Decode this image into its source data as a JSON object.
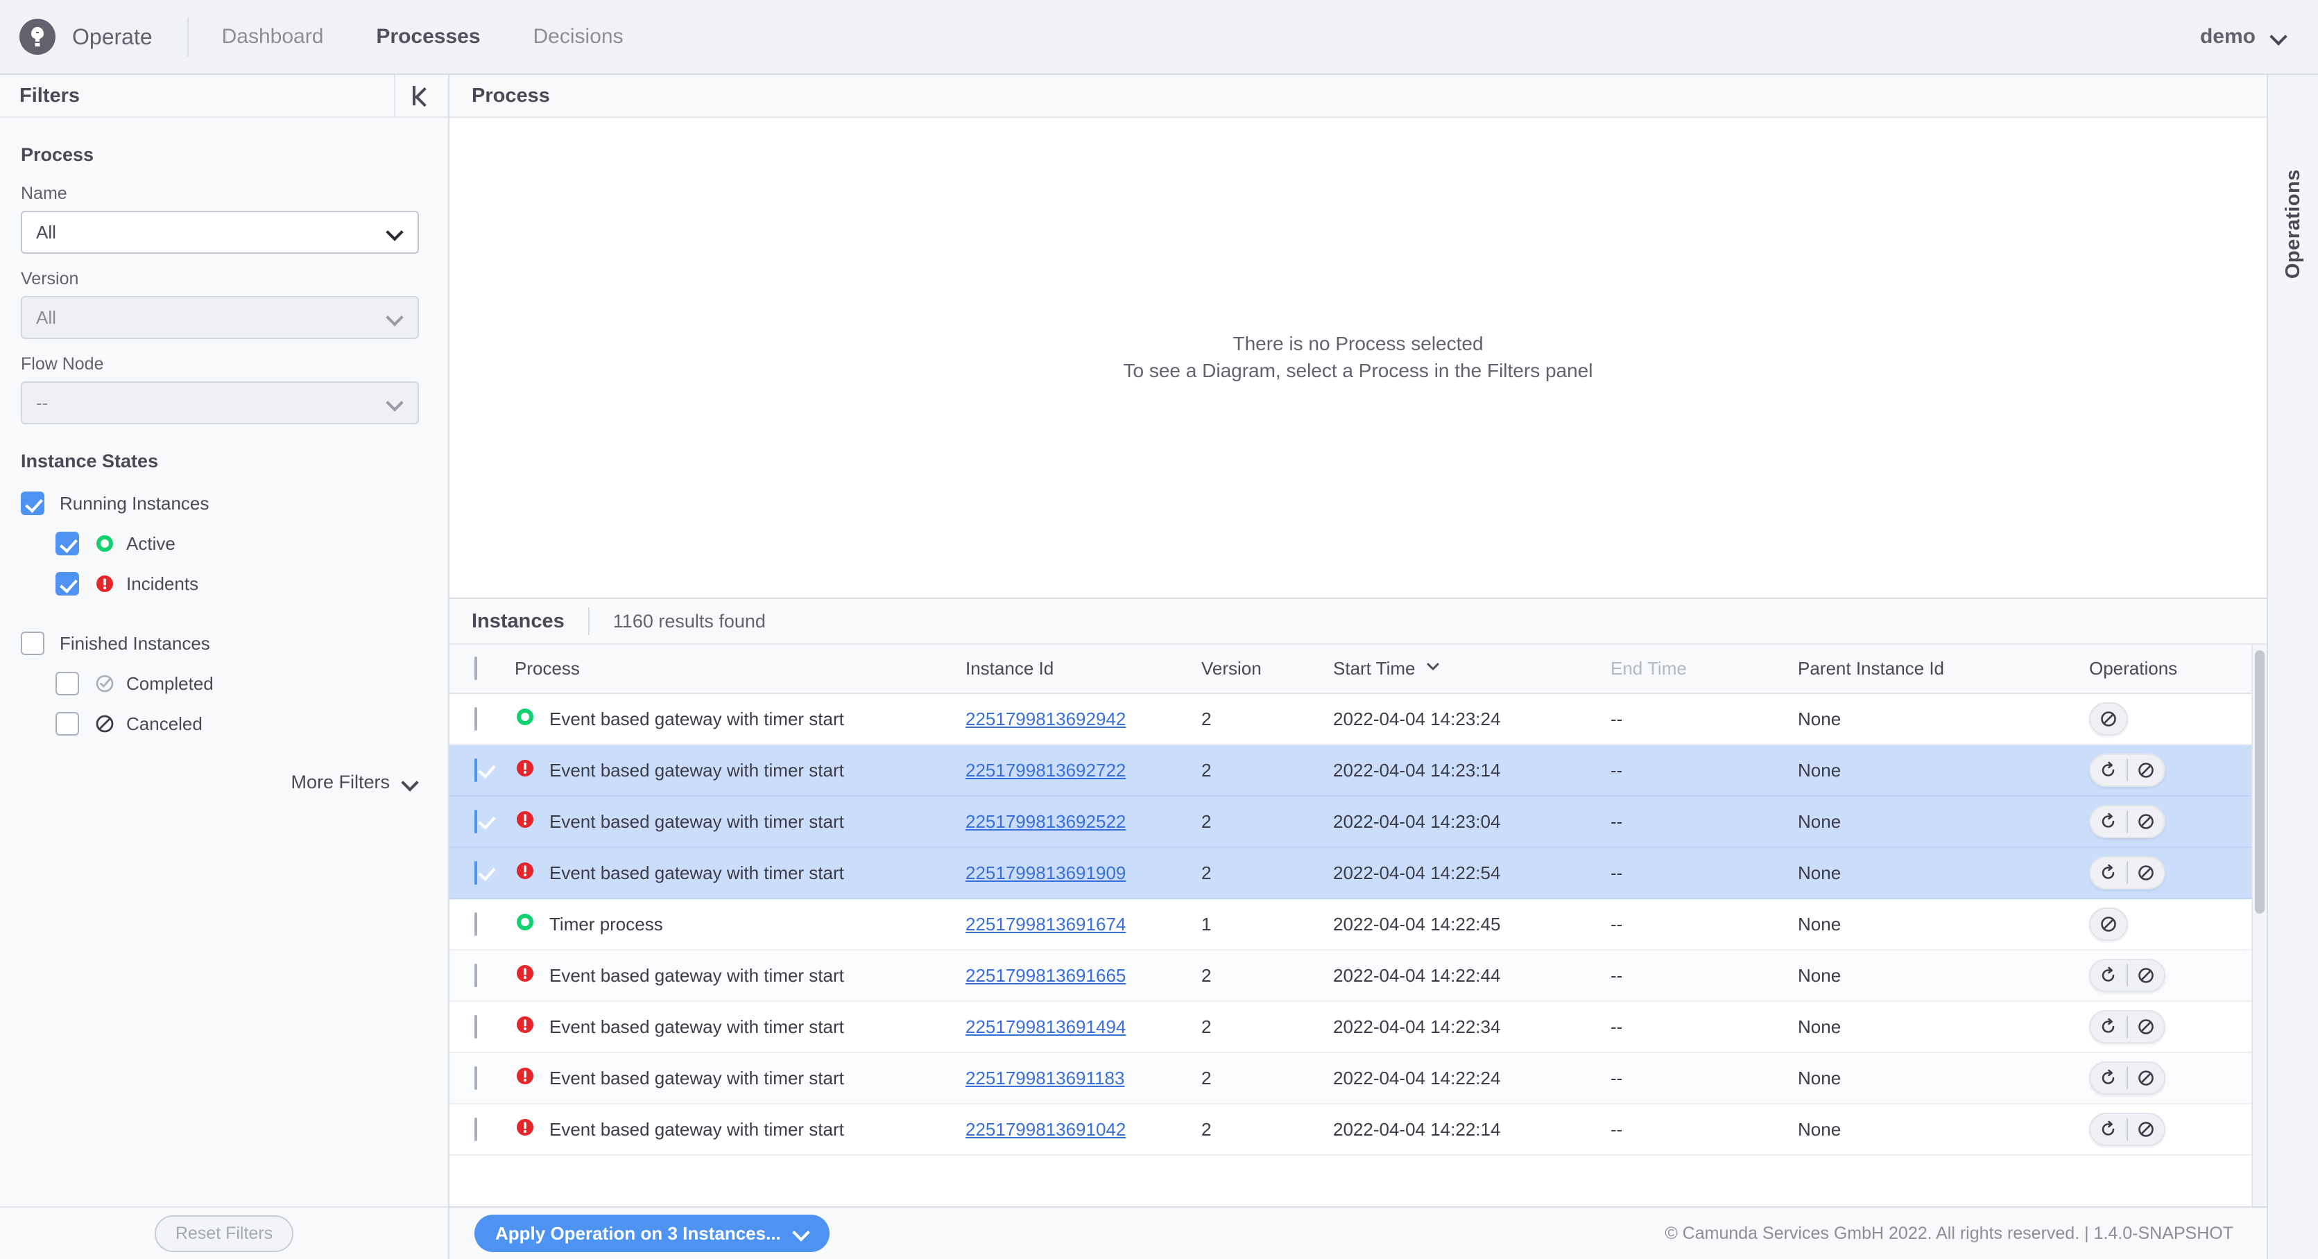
{
  "header": {
    "logo_letter": "C",
    "logo_icon": "camunda-logo-icon",
    "brand": "Operate",
    "nav": [
      {
        "label": "Dashboard",
        "active": false
      },
      {
        "label": "Processes",
        "active": true
      },
      {
        "label": "Decisions",
        "active": false
      }
    ],
    "user": "demo",
    "user_chevron_icon": "chevron-down-icon"
  },
  "sidebar": {
    "title": "Filters",
    "collapse_icon": "collapse-panel-left-icon",
    "process_group_title": "Process",
    "fields": [
      {
        "label": "Name",
        "value": "All",
        "disabled": false
      },
      {
        "label": "Version",
        "value": "All",
        "disabled": true
      },
      {
        "label": "Flow Node",
        "value": "--",
        "disabled": true
      }
    ],
    "instance_states_title": "Instance States",
    "states": [
      {
        "label": "Running Instances",
        "checked": true,
        "indent": false,
        "icon": null
      },
      {
        "label": "Active",
        "checked": true,
        "indent": true,
        "icon": "active-circle-icon"
      },
      {
        "label": "Incidents",
        "checked": true,
        "indent": true,
        "icon": "incident-warning-icon"
      },
      {
        "label": "Finished Instances",
        "checked": false,
        "indent": false,
        "icon": null
      },
      {
        "label": "Completed",
        "checked": false,
        "indent": true,
        "icon": "completed-check-icon"
      },
      {
        "label": "Canceled",
        "checked": false,
        "indent": true,
        "icon": "canceled-slash-icon"
      }
    ],
    "more_filters_label": "More Filters",
    "more_filters_icon": "chevron-down-icon",
    "reset_filters_label": "Reset Filters"
  },
  "diagram_panel": {
    "title": "Process",
    "empty_line_1": "There is no Process selected",
    "empty_line_2": "To see a Diagram, select a Process in the Filters panel"
  },
  "instances_panel": {
    "title": "Instances",
    "results_found": "1160 results found",
    "columns": [
      {
        "key": "process",
        "label": "Process",
        "disabled": false
      },
      {
        "key": "instance_id",
        "label": "Instance Id",
        "disabled": false
      },
      {
        "key": "version",
        "label": "Version",
        "disabled": false
      },
      {
        "key": "start_time",
        "label": "Start Time",
        "disabled": false,
        "sort_icon": "sort-descending-chevron-icon"
      },
      {
        "key": "end_time",
        "label": "End Time",
        "disabled": true
      },
      {
        "key": "parent_instance_id",
        "label": "Parent Instance Id",
        "disabled": false
      },
      {
        "key": "operations",
        "label": "Operations",
        "disabled": false
      }
    ],
    "rows": [
      {
        "selected": false,
        "state": "active",
        "process": "Event based gateway with timer start",
        "instance_id": "2251799813692942",
        "version": "2",
        "start_time": "2022-04-04 14:23:24",
        "end_time": "--",
        "parent_instance_id": "None",
        "ops": [
          "cancel"
        ]
      },
      {
        "selected": true,
        "state": "incident",
        "process": "Event based gateway with timer start",
        "instance_id": "2251799813692722",
        "version": "2",
        "start_time": "2022-04-04 14:23:14",
        "end_time": "--",
        "parent_instance_id": "None",
        "ops": [
          "retry",
          "cancel"
        ]
      },
      {
        "selected": true,
        "state": "incident",
        "process": "Event based gateway with timer start",
        "instance_id": "2251799813692522",
        "version": "2",
        "start_time": "2022-04-04 14:23:04",
        "end_time": "--",
        "parent_instance_id": "None",
        "ops": [
          "retry",
          "cancel"
        ]
      },
      {
        "selected": true,
        "state": "incident",
        "process": "Event based gateway with timer start",
        "instance_id": "2251799813691909",
        "version": "2",
        "start_time": "2022-04-04 14:22:54",
        "end_time": "--",
        "parent_instance_id": "None",
        "ops": [
          "retry",
          "cancel"
        ]
      },
      {
        "selected": false,
        "state": "active",
        "process": "Timer process",
        "instance_id": "2251799813691674",
        "version": "1",
        "start_time": "2022-04-04 14:22:45",
        "end_time": "--",
        "parent_instance_id": "None",
        "ops": [
          "cancel"
        ]
      },
      {
        "selected": false,
        "state": "incident",
        "process": "Event based gateway with timer start",
        "instance_id": "2251799813691665",
        "version": "2",
        "start_time": "2022-04-04 14:22:44",
        "end_time": "--",
        "parent_instance_id": "None",
        "ops": [
          "retry",
          "cancel"
        ]
      },
      {
        "selected": false,
        "state": "incident",
        "process": "Event based gateway with timer start",
        "instance_id": "2251799813691494",
        "version": "2",
        "start_time": "2022-04-04 14:22:34",
        "end_time": "--",
        "parent_instance_id": "None",
        "ops": [
          "retry",
          "cancel"
        ]
      },
      {
        "selected": false,
        "state": "incident",
        "process": "Event based gateway with timer start",
        "instance_id": "2251799813691183",
        "version": "2",
        "start_time": "2022-04-04 14:22:24",
        "end_time": "--",
        "parent_instance_id": "None",
        "ops": [
          "retry",
          "cancel"
        ]
      },
      {
        "selected": false,
        "state": "incident",
        "process": "Event based gateway with timer start",
        "instance_id": "2251799813691042",
        "version": "2",
        "start_time": "2022-04-04 14:22:14",
        "end_time": "--",
        "parent_instance_id": "None",
        "ops": [
          "retry",
          "cancel"
        ]
      }
    ],
    "apply_button_label": "Apply Operation on 3 Instances...",
    "apply_button_icon": "chevron-down-icon",
    "copyright": "© Camunda Services GmbH 2022. All rights reserved. | 1.4.0-SNAPSHOT"
  },
  "right_panel": {
    "label": "Operations"
  },
  "colors": {
    "accent_blue": "#4e93f2",
    "link_blue": "#3a6fd8",
    "selected_row": "#cadefb",
    "active_green": "#10d070",
    "incident_red": "#e4252a",
    "text_dark": "#4a4a57",
    "text_muted": "#8d8d96"
  }
}
